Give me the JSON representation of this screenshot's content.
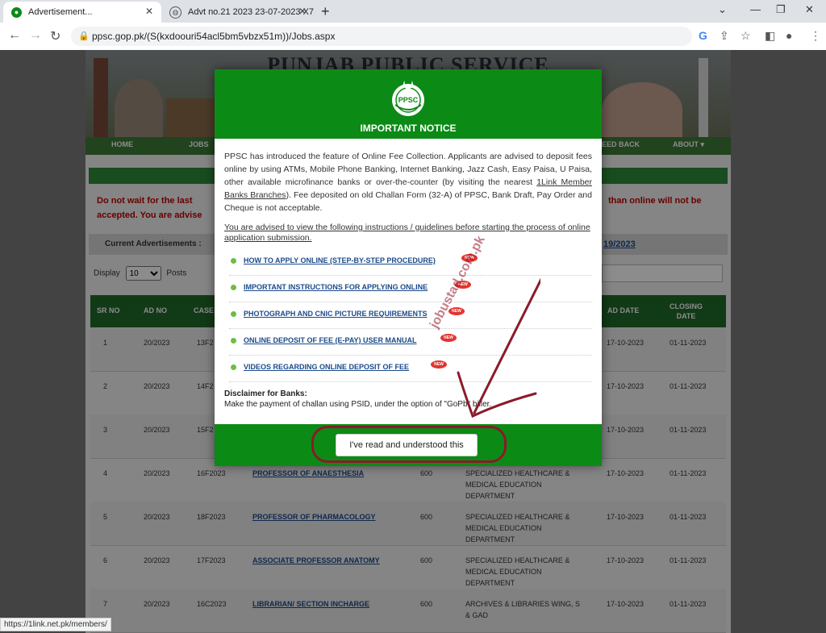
{
  "browser": {
    "tabs": [
      {
        "title": "Advertisement..."
      },
      {
        "title": "Advt no.21 2023 23-07-2023 X7"
      }
    ],
    "url": "ppsc.gop.pk/(S(kxdoouri54acl5bm5vbzx51m))/Jobs.aspx",
    "status_url": "https://1link.net.pk/members/"
  },
  "site": {
    "banner_title": "PUNJAB PUBLIC SERVICE COMMISSION",
    "nav": [
      "HOME",
      "JOBS",
      "EED BACK",
      "ABOUT ▾"
    ],
    "warning_left_1": "Do not wait for the last",
    "warning_right_1": "than online will not be",
    "warning_left_2": "accepted. You are advise",
    "current_ads_label": "Current Advertisements :",
    "current_ads_date": "19/2023",
    "display_label": "Display",
    "display_value": "10",
    "posts_label": "Posts",
    "table_headers": {
      "sr": "SR NO",
      "ad": "AD NO",
      "case": "CASE",
      "addate": "AD DATE",
      "closing_1": "CLOSING",
      "closing_2": "DATE"
    },
    "rows": [
      {
        "sr": "1",
        "ad": "20/2023",
        "case": "13F2",
        "post": "",
        "posts": "",
        "dept_1": "",
        "dept_2": "",
        "dept_3": "",
        "addate": "17-10-2023",
        "closing": "01-11-2023"
      },
      {
        "sr": "2",
        "ad": "20/2023",
        "case": "14F2",
        "post": "",
        "posts": "",
        "dept_1": "",
        "dept_2": "",
        "dept_3": "",
        "addate": "17-10-2023",
        "closing": "01-11-2023"
      },
      {
        "sr": "3",
        "ad": "20/2023",
        "case": "15F2",
        "post": "",
        "posts": "",
        "dept_1": "",
        "dept_2": "",
        "dept_3": "",
        "addate": "17-10-2023",
        "closing": "01-11-2023"
      },
      {
        "sr": "4",
        "ad": "20/2023",
        "case": "16F2023",
        "post": "PROFESSOR OF ANAESTHESIA",
        "posts": "600",
        "dept_1": "SPECIALIZED HEALTHCARE &",
        "dept_2": "MEDICAL EDUCATION",
        "dept_3": "DEPARTMENT",
        "addate": "17-10-2023",
        "closing": "01-11-2023"
      },
      {
        "sr": "5",
        "ad": "20/2023",
        "case": "18F2023",
        "post": "PROFESSOR OF PHARMACOLOGY",
        "posts": "600",
        "dept_1": "SPECIALIZED HEALTHCARE &",
        "dept_2": "MEDICAL EDUCATION",
        "dept_3": "DEPARTMENT",
        "addate": "17-10-2023",
        "closing": "01-11-2023"
      },
      {
        "sr": "6",
        "ad": "20/2023",
        "case": "17F2023",
        "post": "ASSOCIATE PROFESSOR ANATOMY",
        "posts": "600",
        "dept_1": "SPECIALIZED HEALTHCARE &",
        "dept_2": "MEDICAL EDUCATION",
        "dept_3": "DEPARTMENT",
        "addate": "17-10-2023",
        "closing": "01-11-2023"
      },
      {
        "sr": "7",
        "ad": "20/2023",
        "case": "16C2023",
        "post": "LIBRARIAN/ SECTION INCHARGE",
        "posts": "600",
        "dept_1": "ARCHIVES & LIBRARIES WING, S",
        "dept_2": "& GAD",
        "dept_3": "",
        "addate": "17-10-2023",
        "closing": "01-11-2023"
      }
    ]
  },
  "modal": {
    "logo_text": "PPSC",
    "title": "IMPORTANT NOTICE",
    "body_1": "PPSC has introduced the feature of Online Fee Collection. Applicants are advised to deposit fees online by using ATMs, Mobile Phone Banking, Internet Banking, Jazz Cash, Easy Paisa, U Paisa, other available microfinance banks or over-the-counter (by visiting the nearest ",
    "body_link": "1Link Member Banks Branches",
    "body_2": "). Fee deposited on old Challan Form (32-A) of PPSC, Bank Draft, Pay Order and Cheque is not acceptable.",
    "advise": "You are advised to view the following instructions / guidelines before starting the process of online application submission.",
    "new_badge": "NEW",
    "links": [
      "HOW TO APPLY ONLINE (STEP-BY-STEP PROCEDURE)",
      "IMPORTANT INSTRUCTIONS FOR APPLYING ONLINE",
      "PHOTOGRAPH AND CNIC PICTURE REQUIREMENTS",
      "ONLINE DEPOSIT OF FEE (E-PAY) USER MANUAL",
      "VIDEOS REGARDING ONLINE DEPOSIT OF FEE"
    ],
    "disclaimer_title": "Disclaimer for Banks:",
    "disclaimer_text": "Make the payment of challan using PSID, under the option of \"GoPb\" biller.",
    "button": "I've read and understood this"
  },
  "watermark": "jobustad.com.pk",
  "colors": {
    "ppsc_green": "#0c8a16",
    "nav_green": "#3d7a38",
    "annotation_red": "#8b1a2a"
  }
}
